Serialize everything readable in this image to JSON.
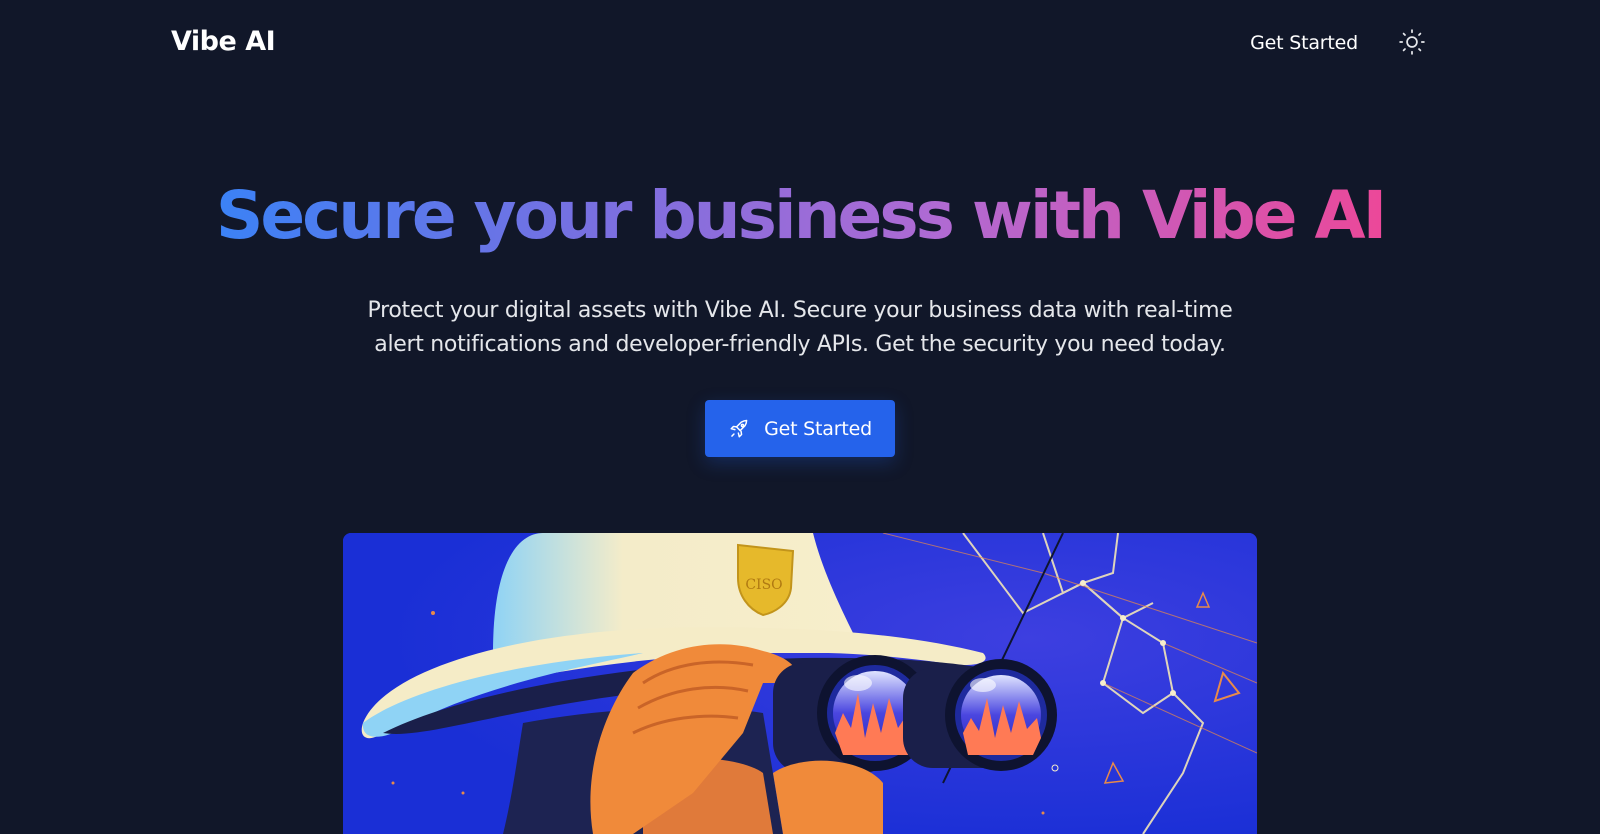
{
  "header": {
    "logo": "Vibe AI",
    "nav_get_started": "Get Started",
    "theme_toggle_icon": "sun-icon"
  },
  "hero": {
    "title": "Secure your business with Vibe AI",
    "subtitle_line1": "Protect your digital assets with Vibe AI. Secure your business data with real-time",
    "subtitle_line2": "alert notifications and developer-friendly APIs. Get the security you need today.",
    "cta_label": "Get Started",
    "cta_icon": "rocket-icon"
  },
  "illustration": {
    "badge_text": "CISO",
    "description_icon": "person-with-binoculars-illustration"
  },
  "colors": {
    "background": "#111729",
    "cta": "#2563eb",
    "gradient_start": "#3b82f6",
    "gradient_end": "#ec4899",
    "illustration_bg": "#1a2fd6"
  }
}
